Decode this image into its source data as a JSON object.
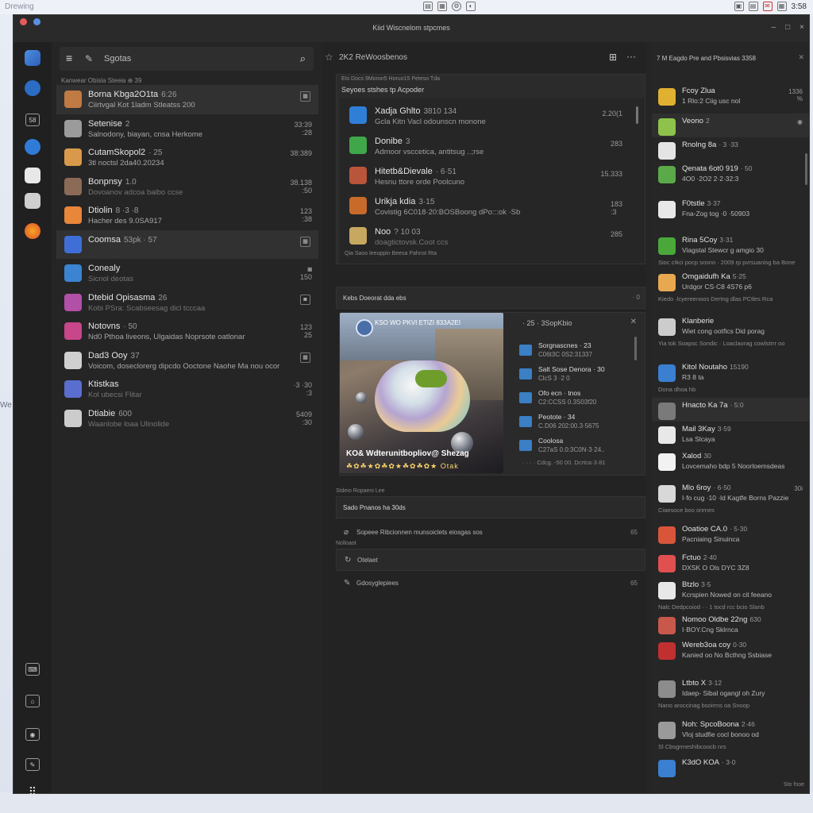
{
  "os": {
    "left_text": "Drewing",
    "time": "3:58",
    "mid_icons": [
      "doc-icon",
      "grid-icon",
      "gear-icon",
      "toggle-icon"
    ],
    "right_icons": [
      "box-icon",
      "chat-icon",
      "mail-icon",
      "grid-icon"
    ]
  },
  "desktop": {
    "side_text": "We"
  },
  "window": {
    "title": "Kiid Wiscnelom stpcmes",
    "controls": [
      "–",
      "□",
      "×"
    ]
  },
  "rail": {
    "icons": [
      {
        "name": "app-logo-icon",
        "color": "#3a7bd5"
      },
      {
        "name": "globe-icon",
        "color": "#2b6cc4"
      },
      {
        "name": "calendar-icon",
        "label": "58"
      },
      {
        "name": "browser-icon",
        "color": "#2f7bd8"
      },
      {
        "name": "dice-icon",
        "color": "#e8e8e8"
      },
      {
        "name": "dice-icon-2",
        "color": "#e8e8e8"
      },
      {
        "name": "firefox-icon",
        "color": "#e96b2b"
      }
    ],
    "bottom_icons": [
      "keyboard-icon",
      "store-icon",
      "camera-icon",
      "edit-icon",
      "apps-grid-icon"
    ],
    "keyboard_label": "⌨"
  },
  "list": {
    "search_placeholder": "Sgotas",
    "head": "Kanwear Obisla  Steeia  ⊕  39",
    "items": [
      {
        "name": "Borna Kbga2O1ta",
        "time": "6:26",
        "sub": "Ciirtvgal Kot 1ladm Stleatss 200",
        "right": "▦",
        "color": "#c07a44",
        "selected": true
      },
      {
        "name": "Setenise",
        "time": "2",
        "sub": "Salnodony, biayan, cnsa Herkome",
        "right": "33:39\n:28",
        "color": "#9b9b9b"
      },
      {
        "name": "CutamSkopol2",
        "time": "· 25",
        "sub": "3tl noctsl 2da40.20234",
        "right": "38:389",
        "color": "#d89a4a"
      },
      {
        "name": "Bonpnsy",
        "time": "1.0",
        "sub": "Dovoanov adcoa baibo ccse",
        "right": "38.138\n:50",
        "color": "#8c6a58",
        "dim": true
      },
      {
        "name": "Dtiolin",
        "time": "8 ·3 ·8",
        "sub": "Hacher des 9.0SA917",
        "right": "123\n:38",
        "color": "#e8863a"
      },
      {
        "name": "Coomsa",
        "time": "53pk · 57",
        "sub": "",
        "right": "▦",
        "color": "#3f6fd6",
        "selected": true
      },
      {
        "name": "Conealy",
        "time": "",
        "sub": "Sicnol deotas",
        "right": "◙\n150",
        "color": "#3a84d2",
        "dim": true
      },
      {
        "name": "Dtebid Opisasma",
        "time": "26",
        "sub": "Kobi PSra: Scabseesag dicl tcccaa",
        "right": "◙",
        "color": "#b24fa6",
        "dim": true
      },
      {
        "name": "Notovns",
        "time": "· 50",
        "sub": "Nd0 Pthoa liveons, Ulgaidas Noprsote oatlonar",
        "right": "123\n25",
        "color": "#c8468a"
      },
      {
        "name": "Dad3 Ooy",
        "time": "37",
        "sub": "Voicom, doseclorerg dipcdo Ooctone   Naohe Ma nou ocor",
        "right": "▦",
        "color": "#d0d0d0"
      },
      {
        "name": "Ktistkas",
        "time": "",
        "sub": "Kol ubecsi Flitar",
        "right": "·3 ·30\n:3",
        "color": "#5a6ed0",
        "dim": true
      },
      {
        "name": "Dtiabie",
        "time": "600",
        "sub": "Waanlobe loaa Ulinolide",
        "right": "5409\n:30",
        "color": "#cccccc",
        "dim": true
      }
    ]
  },
  "center": {
    "header": "2K2 ReWoosbenos",
    "panel1": {
      "hdr1": "Ets Docs 9Monor5 Horuo15 Peteso  Tda",
      "hdr2": "Seyoes stshes tp Acpoder",
      "rows": [
        {
          "name": "Xadja Ghlto",
          "time": "3810 134",
          "sub": "Gcla Kitn Vacl odounscn monone",
          "right": "2.20(1",
          "color": "#2f7fd6"
        },
        {
          "name": "Donibe",
          "time": "3",
          "sub": "Admoor vsccetica, antitsug ..;rse",
          "right": "283",
          "color": "#3fa64a"
        },
        {
          "name": "Hitetb&Dievale",
          "time": "· 6·51",
          "sub": "Hesnu ttore orde Poolcuno",
          "right": "15.333",
          "color": "#b8553a"
        },
        {
          "name": "Urikja kdia",
          "time": "3·15",
          "sub": "Covistig 6C018·20:BOSBoong dPo:::ok ·Sb",
          "right": "183\n:3",
          "color": "#c86a2a"
        },
        {
          "name": "Noo",
          "time": "? 10 03",
          "sub": "doagtictovsk.Coot ccs",
          "right": "285",
          "color": "#c6a860",
          "dim": true
        }
      ],
      "foot": "Qia Saoo leeuppin Beesa Pahnst Rta"
    },
    "bar2": {
      "title": "Kebs Doeorat dda  ebs",
      "right": "· 0"
    },
    "media": {
      "caption_top": "KSO WO PKVI ETIZI 833A2EI",
      "caption": "KO& Wdterunitbopliov@ Shezag",
      "emoji": "☘✿☘★✿☘✿★☘✿☘✿★ Otak",
      "side_header": "· 25 · 3SopKbio",
      "items": [
        {
          "a": "Sorgnascnes · 23",
          "b": "C06t3C 0S2:31337"
        },
        {
          "a": "Salt Sose Denora · 30",
          "b": "ClcS 3 ·2 0"
        },
        {
          "a": "Ofo ecn · tnos",
          "b": "C2:CCSS 0.3S03f20"
        },
        {
          "a": "Peotote · 34",
          "b": "C.D06 202:00.3·5675"
        },
        {
          "a": "Coolosa",
          "b": "C27aS 0.0:3C0N·3·24.."
        }
      ],
      "foot": "· · · · Cdcg. -50 00. Dcrtca·3·81"
    },
    "lbl1": "Stdeio Ropaeni Lee",
    "action1": {
      "title": "Sado Pnanos ha 30ds",
      "right": ""
    },
    "action2": {
      "title": "Sopeee Ribcionnen munsoiclets eiosgas sos",
      "right": "65"
    },
    "lbl2": "Nolloaot",
    "action3": {
      "title": "Otelaet",
      "right": ""
    },
    "action4": {
      "title": "Gdosyglepiees",
      "right": "65"
    }
  },
  "right": {
    "header": "7 M Eagdo Pre and Pbsisvias  3358",
    "items": [
      {
        "name": "Fcoy Zlua",
        "time": "",
        "sub": "1 Rlo:2 Ciig usc nol",
        "note": "",
        "right": "1336\n%",
        "color": "#e0b030",
        "h": 38
      },
      {
        "name": "Veono",
        "time": "2",
        "sub": "",
        "note": "",
        "right": "◉",
        "color": "#8ec24a",
        "h": 30,
        "selected": true
      },
      {
        "name": "Rnolng 8a",
        "time": "· 3 ·33",
        "sub": "",
        "note": "",
        "right": "",
        "color": "#e4e4e4",
        "h": 30
      },
      {
        "name": "Qenata 6ot0 919",
        "time": "· 50",
        "sub": "4O0 ·2O2 2·2·32:3",
        "note": "",
        "right": "",
        "color": "#5aaa4a",
        "h": 44
      },
      {
        "name": "F0tstle",
        "time": "3·37",
        "sub": "Fna-Zog tog ·0 ·50903",
        "note": "",
        "right": "",
        "color": "#e8e8e8",
        "h": 46
      },
      {
        "name": "Rina 5Coy",
        "time": "3·31",
        "sub": "Viagstal Stewcr g amgio 30",
        "note": "Sioc cIkci pocp sosno · 2009 rp pvrsuanisg ba Bone",
        "right": "",
        "color": "#4aa83a",
        "h": 46
      },
      {
        "name": "Omgaidufh Ka",
        "time": "5·25",
        "sub": "Urdgor CS·C8 4S76 p6",
        "note": "Kiedo ·lcyereenoos Dertng dlas PCtles Rca",
        "right": "",
        "color": "#e8a850",
        "h": 56
      },
      {
        "name": "Klanberie",
        "time": "",
        "sub": "Wiet cong ootfics Did porag",
        "note": "Yia tok Soapsc Sondic · Loaclaorag cowlstrrr oo",
        "right": "",
        "color": "#cccccc",
        "h": 58
      },
      {
        "name": "Kitol Noutaho",
        "time": "15190",
        "sub": "R3 8 ta",
        "note": "Dona dhoa hb",
        "right": "",
        "color": "#3a7fd0",
        "h": 48
      },
      {
        "name": "Hnacto Ka 7a",
        "time": "· 5:0",
        "sub": "",
        "note": "",
        "right": "",
        "color": "#7a7a7a",
        "h": 30,
        "selected": true
      },
      {
        "name": "Mail 3Kay",
        "time": "3·59",
        "sub": "Lsa Slcaya",
        "note": "",
        "right": "",
        "color": "#e8e8e8",
        "h": 34
      },
      {
        "name": "Xalod",
        "time": "30",
        "sub": "Lovcemaho bdp  5 Noorloemsdeas",
        "note": "",
        "right": "",
        "color": "#f2f2f2",
        "h": 40
      },
      {
        "name": "Mlo 6roy",
        "time": "· 6·50",
        "sub": "I·fo cug ·10 ·ld Kagtfe Borns Pazzie",
        "note": "Ciaesoce boo onrnes",
        "right": "30i",
        "color": "#d8d8d8",
        "h": 52
      },
      {
        "name": "Ooatioe CA.0",
        "time": "· 5·30",
        "sub": "Pacniaing Sinuinca",
        "note": "",
        "right": "",
        "color": "#d8553a",
        "h": 36
      },
      {
        "name": "Fctuo",
        "time": "2·40",
        "sub": "DXSK O Ols DYC 3Z8",
        "note": "",
        "right": "",
        "color": "#e05050",
        "h": 34
      },
      {
        "name": "Btzlo",
        "time": "3·5",
        "sub": "Kcrspien Nowed on cit feeano",
        "note": "Nalc Dedpcoiod · · 1 tocd rcc bcio Slanb",
        "right": "",
        "color": "#e8e8e8",
        "h": 44
      },
      {
        "name": "Nomoo Oldbe 22ng",
        "time": "630",
        "sub": "I·BOY.Cng Sklrnca",
        "note": "",
        "right": "",
        "color": "#c8584a",
        "h": 32
      },
      {
        "name": "Wereb3oa coy",
        "time": "0·30",
        "sub": "Kanied oo No Bcthng Ssbiase",
        "note": "",
        "right": "",
        "color": "#c03030",
        "h": 48
      },
      {
        "name": "Ltbto X",
        "time": "3·12",
        "sub": "Idaep- Sibal ogangl oh Zury",
        "note": "Nano aroccinag bsoirms oa Snoop",
        "right": "",
        "color": "#8c8c8c",
        "h": 52
      },
      {
        "name": "Noh: SpcoBoona",
        "time": "2·46",
        "sub": "Vloj studfie cocl bonoo od",
        "note": "Sl Cbsgrmeshibcoocb nrs",
        "right": "",
        "color": "#9a9a9a",
        "h": 48
      },
      {
        "name": "K3dO KOA",
        "time": "· 3·0",
        "sub": "",
        "note": "",
        "right": "",
        "color": "#3a7fd0",
        "h": 30
      }
    ],
    "foot": "Sto fnoe"
  }
}
